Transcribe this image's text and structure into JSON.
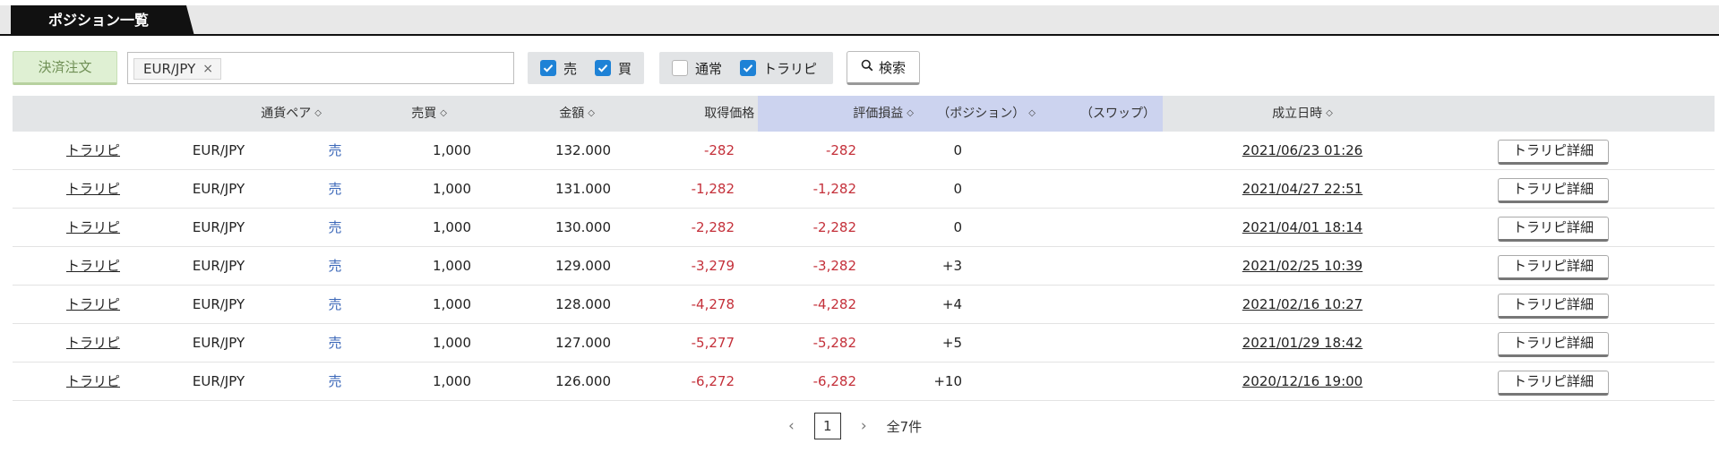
{
  "header": {
    "tab_title": "ポジション一覧"
  },
  "toolbar": {
    "settle_label": "決済注文",
    "filter_tag": "EUR/JPY",
    "tag_remove": "×",
    "side_filters": [
      {
        "label": "売",
        "checked": true
      },
      {
        "label": "買",
        "checked": true
      }
    ],
    "type_filters": [
      {
        "label": "通常",
        "checked": false
      },
      {
        "label": "トラリピ",
        "checked": true
      }
    ],
    "search_label": "検索"
  },
  "table": {
    "headers": {
      "pair": "通貨ペア",
      "side": "売買",
      "amount": "金額",
      "price": "取得価格",
      "pnl": "評価損益",
      "position": "（ポジション）",
      "swap": "（スワップ）",
      "datetime": "成立日時"
    },
    "detail_label": "トラリピ詳細",
    "rows": [
      {
        "type": "トラリピ",
        "pair": "EUR/JPY",
        "side": "売",
        "amount": "1,000",
        "price": "132.000",
        "pnl": "-282",
        "position": "-282",
        "swap": "0",
        "datetime": "2021/06/23 01:26"
      },
      {
        "type": "トラリピ",
        "pair": "EUR/JPY",
        "side": "売",
        "amount": "1,000",
        "price": "131.000",
        "pnl": "-1,282",
        "position": "-1,282",
        "swap": "0",
        "datetime": "2021/04/27 22:51"
      },
      {
        "type": "トラリピ",
        "pair": "EUR/JPY",
        "side": "売",
        "amount": "1,000",
        "price": "130.000",
        "pnl": "-2,282",
        "position": "-2,282",
        "swap": "0",
        "datetime": "2021/04/01 18:14"
      },
      {
        "type": "トラリピ",
        "pair": "EUR/JPY",
        "side": "売",
        "amount": "1,000",
        "price": "129.000",
        "pnl": "-3,279",
        "position": "-3,282",
        "swap": "+3",
        "datetime": "2021/02/25 10:39"
      },
      {
        "type": "トラリピ",
        "pair": "EUR/JPY",
        "side": "売",
        "amount": "1,000",
        "price": "128.000",
        "pnl": "-4,278",
        "position": "-4,282",
        "swap": "+4",
        "datetime": "2021/02/16 10:27"
      },
      {
        "type": "トラリピ",
        "pair": "EUR/JPY",
        "side": "売",
        "amount": "1,000",
        "price": "127.000",
        "pnl": "-5,277",
        "position": "-5,282",
        "swap": "+5",
        "datetime": "2021/01/29 18:42"
      },
      {
        "type": "トラリピ",
        "pair": "EUR/JPY",
        "side": "売",
        "amount": "1,000",
        "price": "126.000",
        "pnl": "-6,272",
        "position": "-6,282",
        "swap": "+10",
        "datetime": "2020/12/16 19:00"
      }
    ]
  },
  "pagination": {
    "prev": "‹",
    "current": "1",
    "next": "›",
    "total": "全7件"
  },
  "colors": {
    "negative": "#c4303a",
    "sell": "#3b67b8",
    "checkbox": "#1e82d6",
    "highlight_header": "#ccd3ef"
  }
}
